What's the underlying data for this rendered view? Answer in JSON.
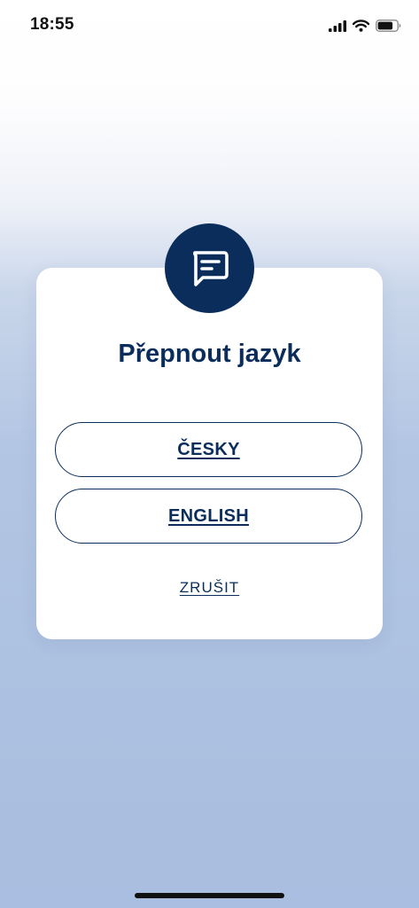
{
  "status_bar": {
    "time": "18:55",
    "icons": [
      "cellular-signal-icon",
      "wifi-icon",
      "battery-icon"
    ]
  },
  "dialog": {
    "icon": "chat-message-icon",
    "title": "Přepnout jazyk",
    "options": [
      {
        "label": "ČESKY"
      },
      {
        "label": "ENGLISH"
      }
    ],
    "cancel_label": "ZRUŠIT"
  },
  "colors": {
    "primary": "#0a2d5c",
    "dialog_background": "#ffffff",
    "backdrop_top": "#ffffff",
    "backdrop_bottom": "#a9bee0"
  }
}
